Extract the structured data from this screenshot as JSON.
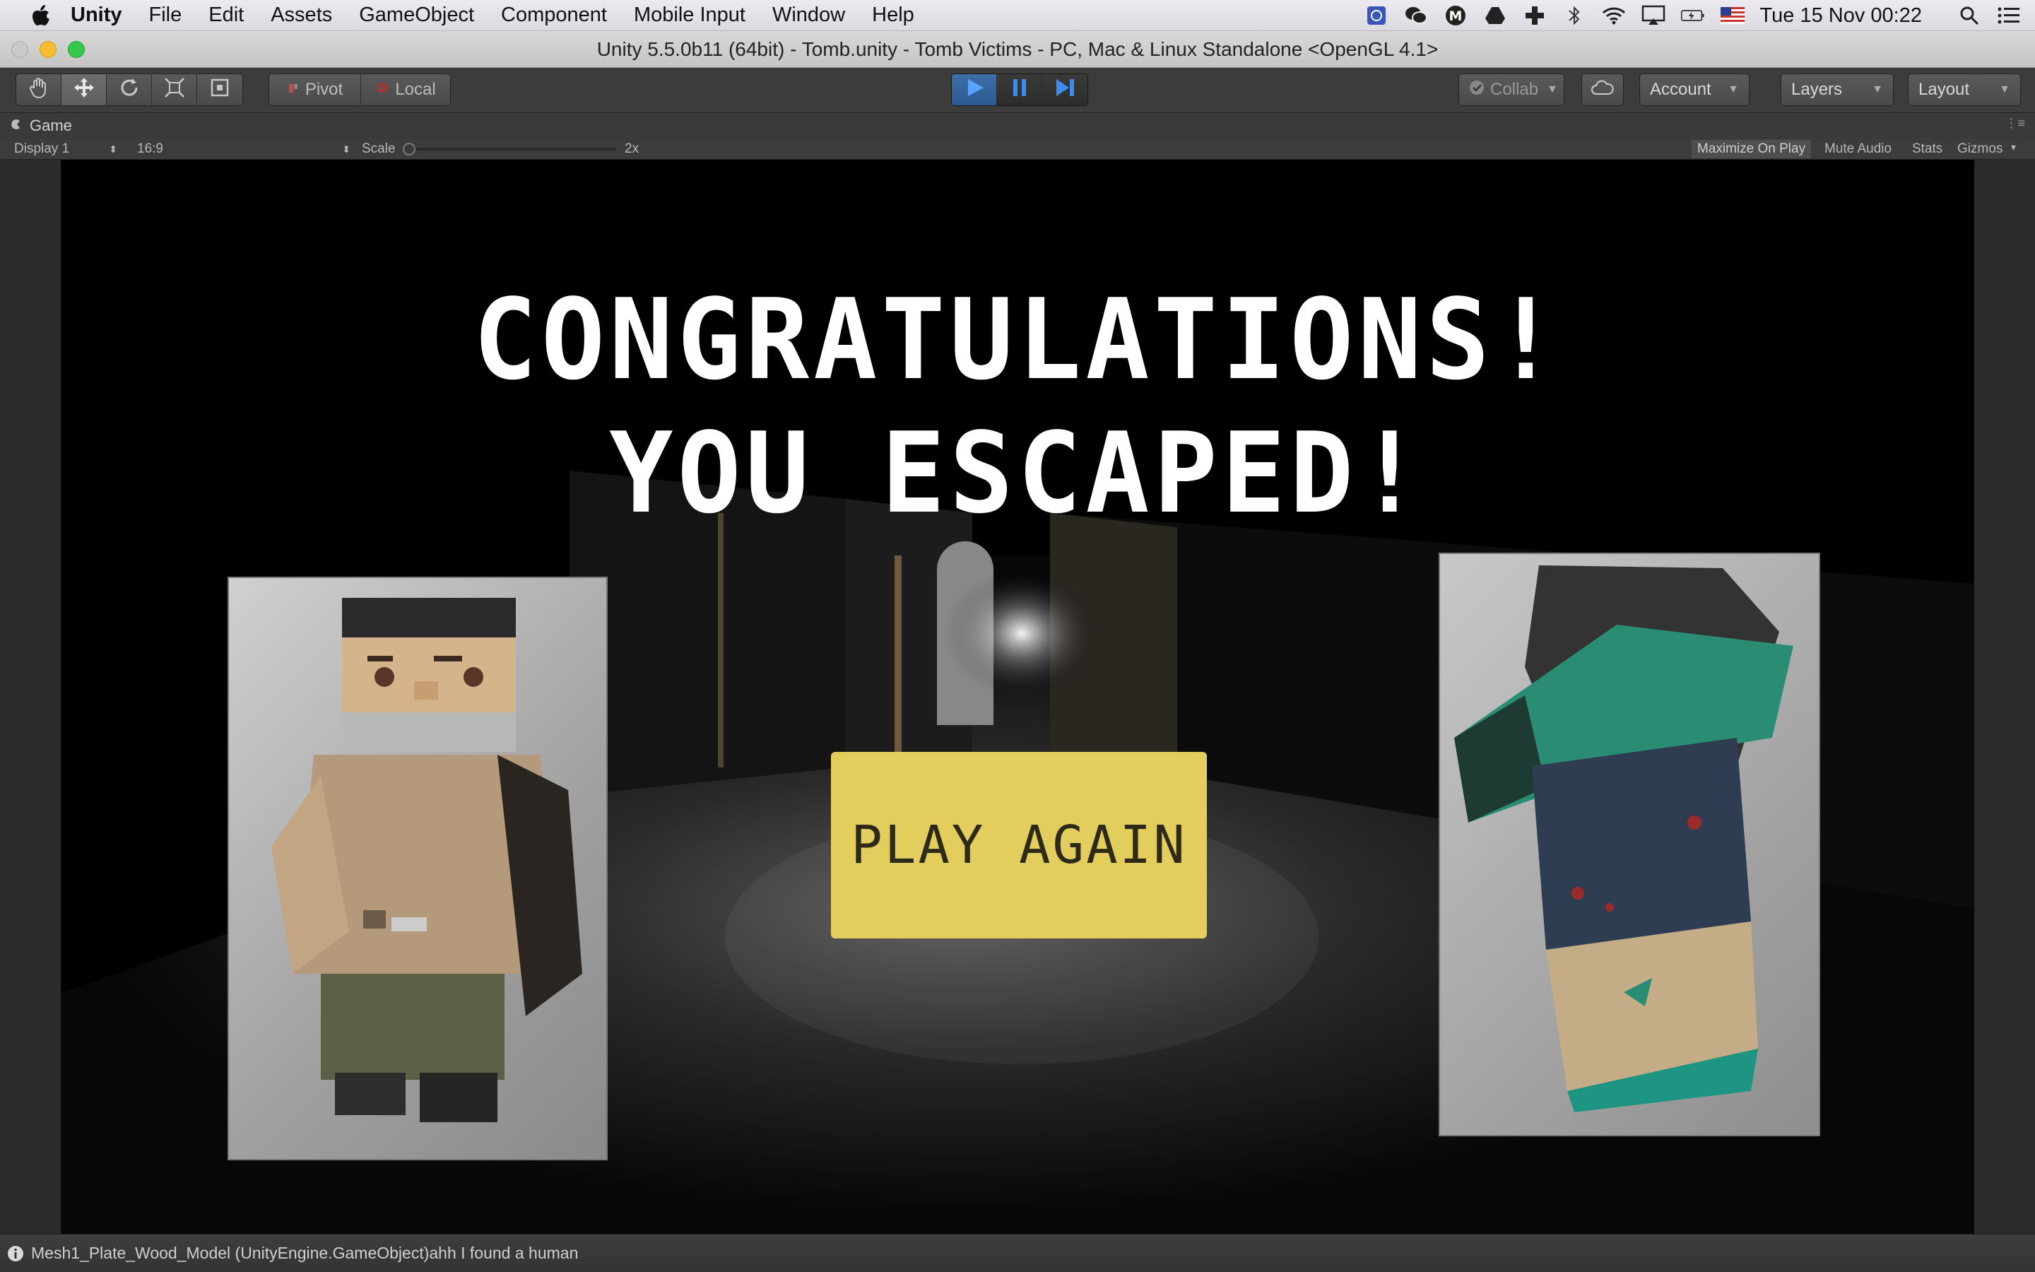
{
  "menubar": {
    "app_name": "Unity",
    "items": [
      "File",
      "Edit",
      "Assets",
      "GameObject",
      "Component",
      "Mobile Input",
      "Window",
      "Help"
    ],
    "clock": "Tue 15 Nov  00:22",
    "status_icons": [
      "tray-app-icon",
      "wechat-icon",
      "m-app-icon",
      "drive-icon",
      "plus-app-icon",
      "bluetooth-icon",
      "wifi-icon",
      "airplay-icon",
      "battery-icon",
      "us-flag-icon",
      "spotlight-icon",
      "notification-center-icon"
    ]
  },
  "window": {
    "title": "Unity 5.5.0b11 (64bit) - Tomb.unity - Tomb Victims - PC, Mac & Linux Standalone <OpenGL 4.1>"
  },
  "toolbar": {
    "transform_tools": [
      "hand-icon",
      "move-icon",
      "rotate-icon",
      "scale-icon",
      "rect-tool-icon"
    ],
    "pivot_label": "Pivot",
    "local_label": "Local",
    "collab_label": "Collab",
    "account_label": "Account",
    "layers_label": "Layers",
    "layout_label": "Layout",
    "accent_color": "#2e7cd6"
  },
  "game_tab": {
    "label": "Game",
    "display": "Display 1",
    "aspect": "16:9",
    "scale_label": "Scale",
    "scale_value": "2x",
    "scale_fraction": 0.0,
    "maximize_label": "Maximize On Play",
    "mute_label": "Mute Audio",
    "stats_label": "Stats",
    "gizmos_label": "Gizmos"
  },
  "game": {
    "title_line1": "CONGRATULATIONS!",
    "title_line2": "YOU ESCAPED!",
    "play_again_label": "PLAY AGAIN",
    "button_color": "#e3cd5c"
  },
  "console": {
    "message": "Mesh1_Plate_Wood_Model (UnityEngine.GameObject)ahh I found a human"
  }
}
